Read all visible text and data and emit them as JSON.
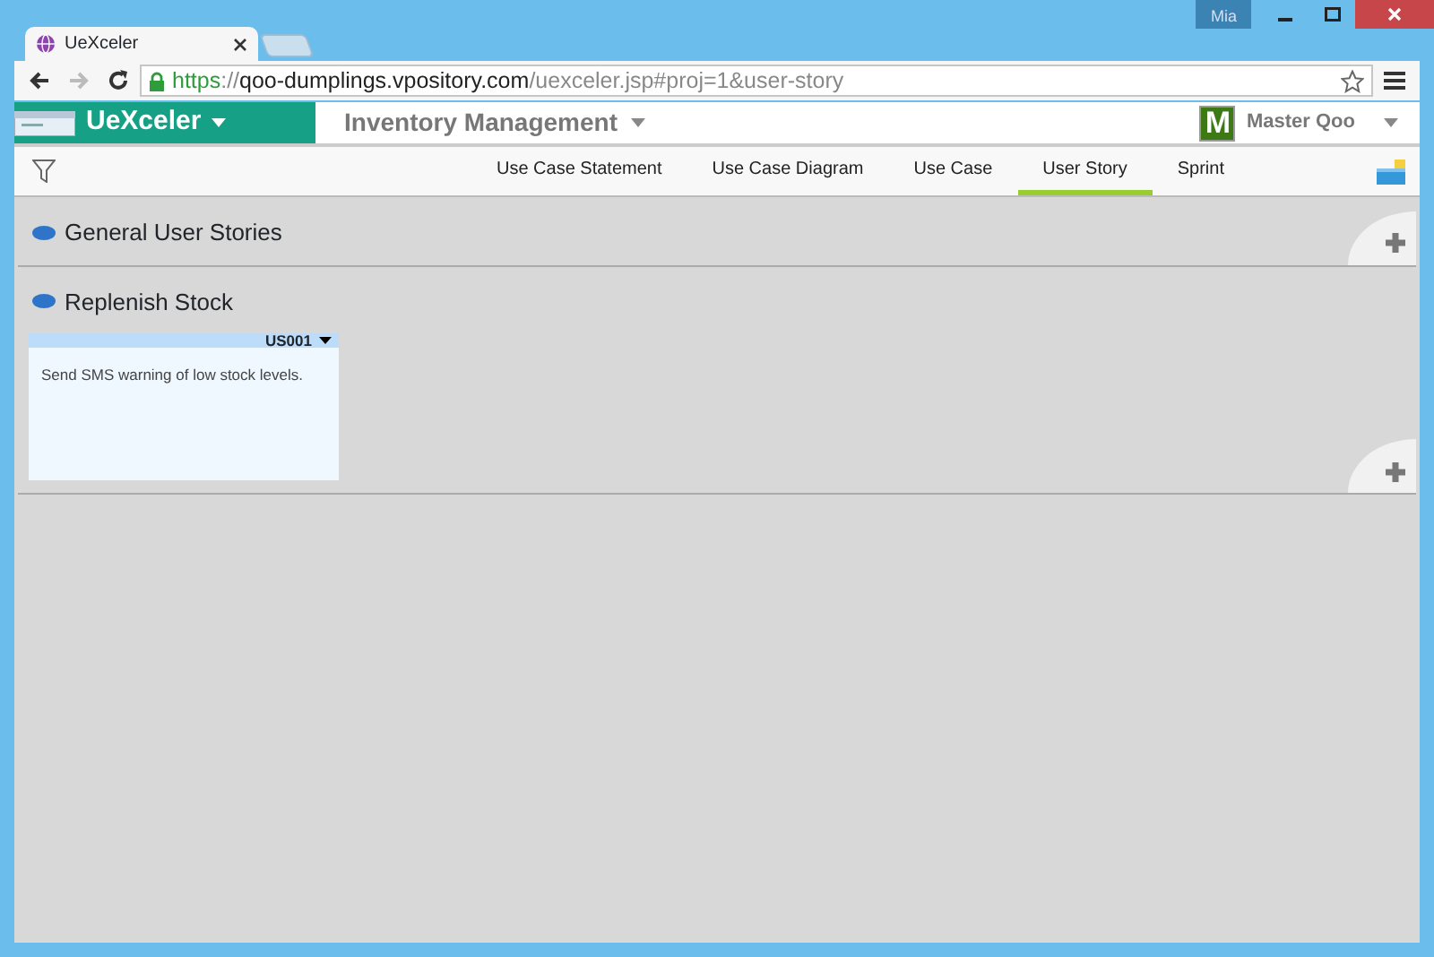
{
  "browser": {
    "tab": {
      "title": "UeXceler",
      "selected": true
    },
    "user_badge": "Mia",
    "url": {
      "scheme": "https",
      "separator": "://",
      "host": "qoo-dumplings.vpository.com",
      "path": "/uexceler.jsp#proj=1&user-story"
    }
  },
  "app": {
    "brand": "UeXceler",
    "project": "Inventory Management",
    "user": {
      "initial": "M",
      "name": "Master Qoo"
    },
    "tabs": [
      {
        "label": "Use Case Statement",
        "selected": false
      },
      {
        "label": "Use Case Diagram",
        "selected": false
      },
      {
        "label": "Use Case",
        "selected": false
      },
      {
        "label": "User Story",
        "selected": true
      },
      {
        "label": "Sprint",
        "selected": false
      }
    ]
  },
  "sections": [
    {
      "title": "General User Stories"
    },
    {
      "title": "Replenish Stock",
      "cards": [
        {
          "id": "US001",
          "text": "Send SMS warning of low stock levels."
        }
      ]
    }
  ]
}
